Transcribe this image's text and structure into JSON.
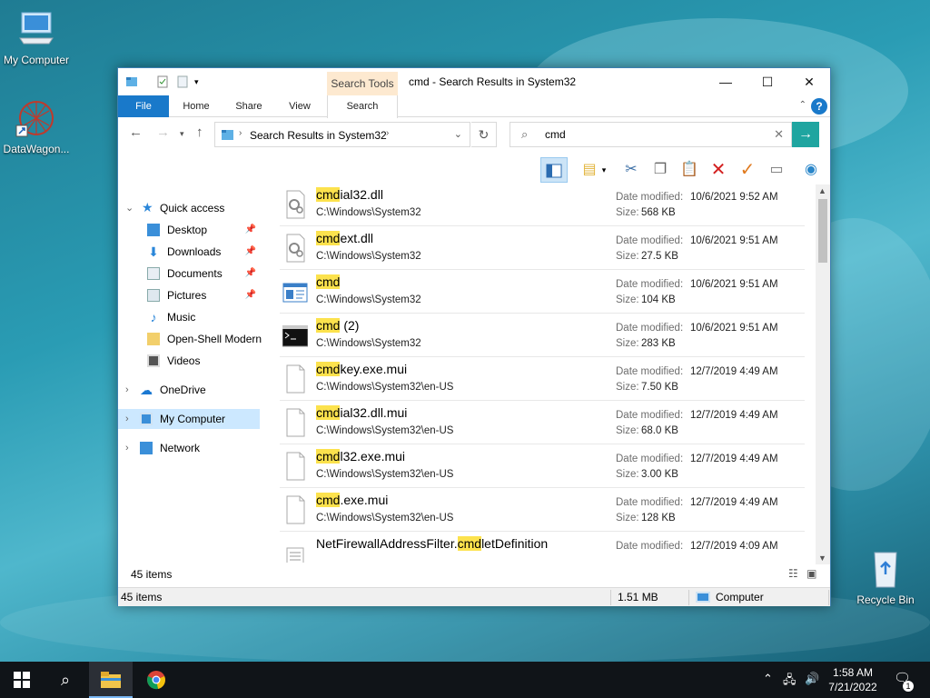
{
  "desktop": {
    "icons": [
      {
        "label": "My Computer"
      },
      {
        "label": "DataWagon..."
      },
      {
        "label": "Recycle Bin"
      }
    ]
  },
  "window": {
    "title": "cmd - Search Results in System32",
    "context_tab_group": "Search Tools",
    "ribbon_tabs": [
      "File",
      "Home",
      "Share",
      "View",
      "Search"
    ],
    "address": "Search Results in System32",
    "search": {
      "value": "cmd",
      "placeholder": ""
    },
    "nav_pane": [
      {
        "label": "Quick access",
        "icon": "star-icon",
        "level": 0,
        "expander": "expanded"
      },
      {
        "label": "Desktop",
        "icon": "desktop-folder-icon",
        "level": 1,
        "pinned": true
      },
      {
        "label": "Downloads",
        "icon": "downloads-icon",
        "level": 1,
        "pinned": true
      },
      {
        "label": "Documents",
        "icon": "documents-icon",
        "level": 1,
        "pinned": true
      },
      {
        "label": "Pictures",
        "icon": "pictures-icon",
        "level": 1,
        "pinned": true
      },
      {
        "label": "Music",
        "icon": "music-icon",
        "level": 1,
        "pinned": false
      },
      {
        "label": "Open-Shell Modern",
        "icon": "folder-icon",
        "level": 1,
        "pinned": false
      },
      {
        "label": "Videos",
        "icon": "videos-icon",
        "level": 1,
        "pinned": false
      },
      {
        "label": "OneDrive",
        "icon": "onedrive-icon",
        "level": 0,
        "expander": "collapsed"
      },
      {
        "label": "My Computer",
        "icon": "computer-icon",
        "level": 0,
        "expander": "collapsed",
        "selected": true
      },
      {
        "label": "Network",
        "icon": "network-icon",
        "level": 0,
        "expander": "collapsed"
      }
    ],
    "results": [
      {
        "match": "cmd",
        "rest": "ial32.dll",
        "pre": "",
        "path": "C:\\Windows\\System32",
        "date_label": "Date modified:",
        "date": "10/6/2021 9:52 AM",
        "size_label": "Size:",
        "size": "568 KB",
        "icon": "dll-gear-icon"
      },
      {
        "match": "cmd",
        "rest": "ext.dll",
        "pre": "",
        "path": "C:\\Windows\\System32",
        "date_label": "Date modified:",
        "date": "10/6/2021 9:51 AM",
        "size_label": "Size:",
        "size": "27.5 KB",
        "icon": "dll-gear-icon"
      },
      {
        "match": "cmd",
        "rest": "",
        "pre": "",
        "path": "C:\\Windows\\System32",
        "date_label": "Date modified:",
        "date": "10/6/2021 9:51 AM",
        "size_label": "Size:",
        "size": "104 KB",
        "icon": "script-file-icon"
      },
      {
        "match": "cmd",
        "rest": " (2)",
        "pre": "",
        "path": "C:\\Windows\\System32",
        "date_label": "Date modified:",
        "date": "10/6/2021 9:51 AM",
        "size_label": "Size:",
        "size": "283 KB",
        "icon": "console-icon"
      },
      {
        "match": "cmd",
        "rest": "key.exe.mui",
        "pre": "",
        "path": "C:\\Windows\\System32\\en-US",
        "date_label": "Date modified:",
        "date": "12/7/2019 4:49 AM",
        "size_label": "Size:",
        "size": "7.50 KB",
        "icon": "blank-file-icon"
      },
      {
        "match": "cmd",
        "rest": "ial32.dll.mui",
        "pre": "",
        "path": "C:\\Windows\\System32\\en-US",
        "date_label": "Date modified:",
        "date": "12/7/2019 4:49 AM",
        "size_label": "Size:",
        "size": "68.0 KB",
        "icon": "blank-file-icon"
      },
      {
        "match": "cmd",
        "rest": "l32.exe.mui",
        "pre": "",
        "path": "C:\\Windows\\System32\\en-US",
        "date_label": "Date modified:",
        "date": "12/7/2019 4:49 AM",
        "size_label": "Size:",
        "size": "3.00 KB",
        "icon": "blank-file-icon"
      },
      {
        "match": "cmd",
        "rest": ".exe.mui",
        "pre": "",
        "path": "C:\\Windows\\System32\\en-US",
        "date_label": "Date modified:",
        "date": "12/7/2019 4:49 AM",
        "size_label": "Size:",
        "size": "128 KB",
        "icon": "blank-file-icon"
      },
      {
        "match": "cmd",
        "rest": "letDefinition",
        "pre": "NetFirewallAddressFilter.",
        "path": "",
        "date_label": "Date modified:",
        "date": "12/7/2019 4:09 AM",
        "size_label": "",
        "size": "",
        "icon": "text-file-icon"
      }
    ],
    "item_count": "45 items",
    "status": {
      "items": "45 items",
      "size": "1.51 MB",
      "location": "Computer"
    }
  },
  "taskbar": {
    "time": "1:58 AM",
    "date": "7/21/2022",
    "notification_count": "1"
  }
}
